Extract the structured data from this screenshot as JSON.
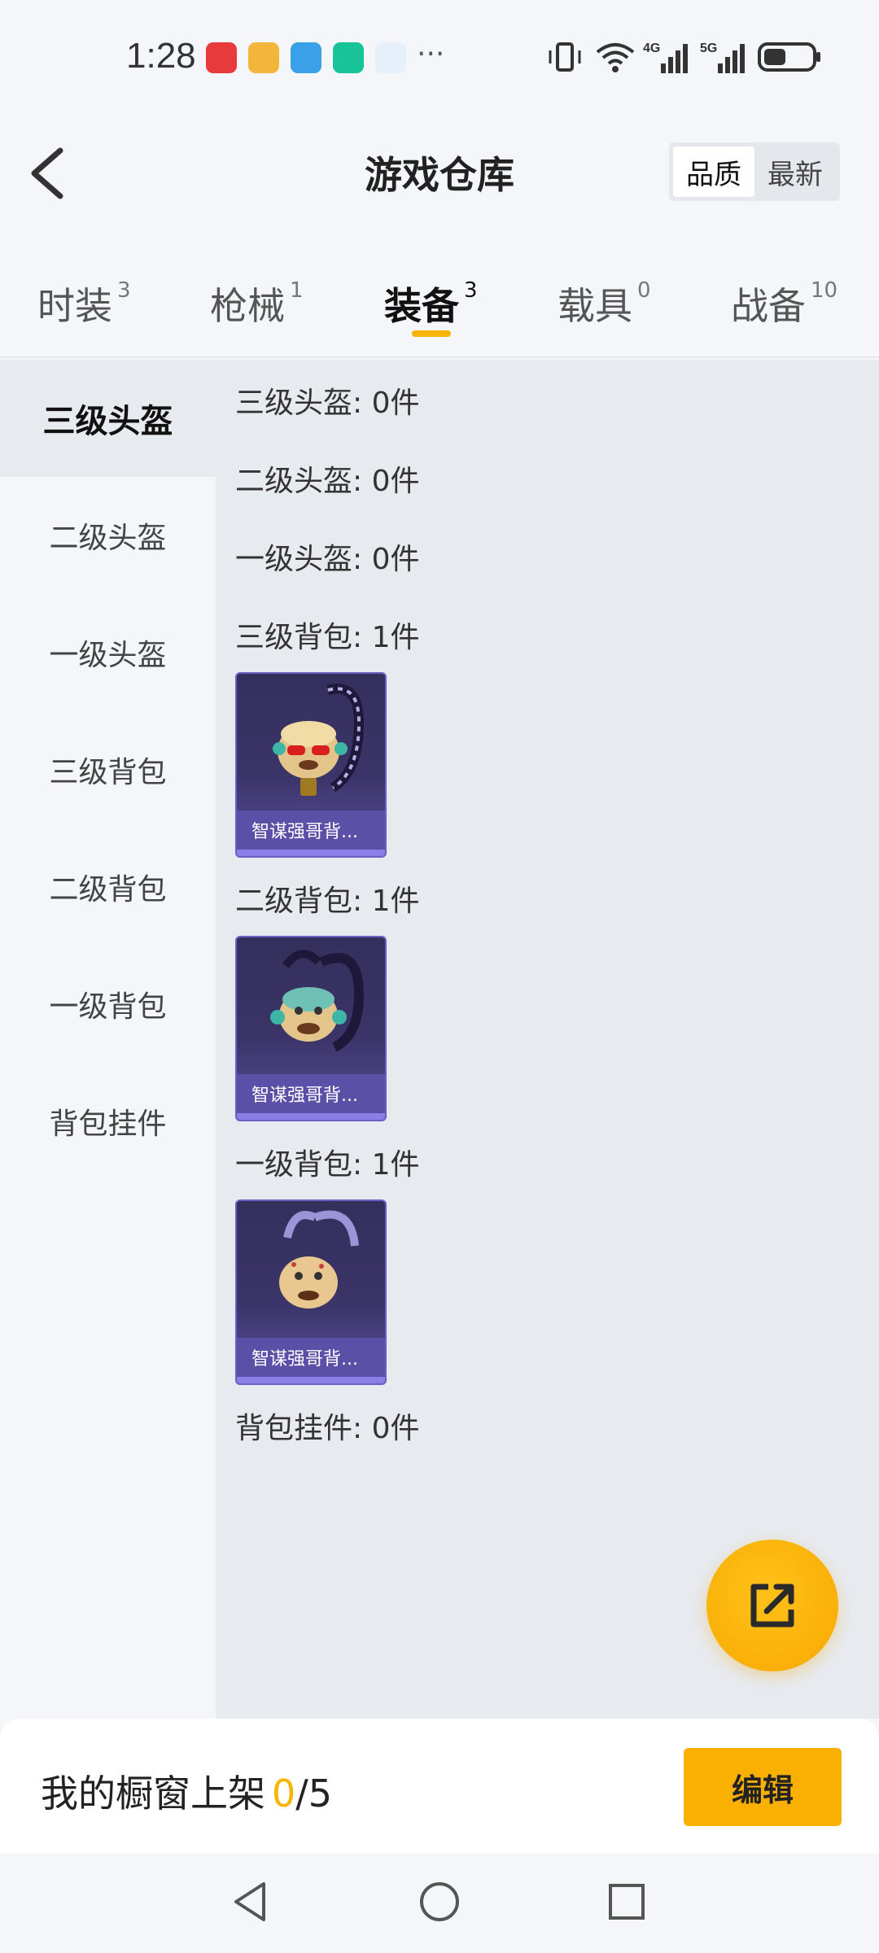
{
  "status_bar": {
    "time": "1:28",
    "more_notifications": "···",
    "network_labels": [
      "4G",
      "5G"
    ],
    "icons": [
      "huawei-store-icon",
      "game-app-icon",
      "app-icon",
      "security-icon",
      "browser-icon",
      "vibrate-icon",
      "wifi-icon",
      "signal-4g-icon",
      "signal-5g-icon",
      "battery-icon"
    ]
  },
  "header": {
    "title": "游戏仓库",
    "sort_options": [
      "品质",
      "最新"
    ],
    "sort_active": "品质"
  },
  "tabs": [
    {
      "label": "时装",
      "count": "3"
    },
    {
      "label": "枪械",
      "count": "1"
    },
    {
      "label": "装备",
      "count": "3",
      "active": true
    },
    {
      "label": "载具",
      "count": "0"
    },
    {
      "label": "战备",
      "count": "10"
    }
  ],
  "sidebar": {
    "items": [
      {
        "label": "三级头盔",
        "active": true
      },
      {
        "label": "二级头盔"
      },
      {
        "label": "一级头盔"
      },
      {
        "label": "三级背包"
      },
      {
        "label": "二级背包"
      },
      {
        "label": "一级背包"
      },
      {
        "label": "背包挂件"
      }
    ]
  },
  "sections": [
    {
      "title": "三级头盔: 0件"
    },
    {
      "title": "二级头盔: 0件"
    },
    {
      "title": "一级头盔: 0件"
    },
    {
      "title": "三级背包: 1件",
      "item_name": "智谋强哥背..."
    },
    {
      "title": "二级背包: 1件",
      "item_name": "智谋强哥背..."
    },
    {
      "title": "一级背包: 1件",
      "item_name": "智谋强哥背..."
    },
    {
      "title": "背包挂件: 0件"
    }
  ],
  "bottom_bar": {
    "label": "我的橱窗上架",
    "count": "0",
    "total": "/5",
    "edit_label": "编辑"
  },
  "colors": {
    "accent": "#f7b500",
    "card_bg": "#3a3468",
    "card_label_bg": "#5a50a8"
  }
}
